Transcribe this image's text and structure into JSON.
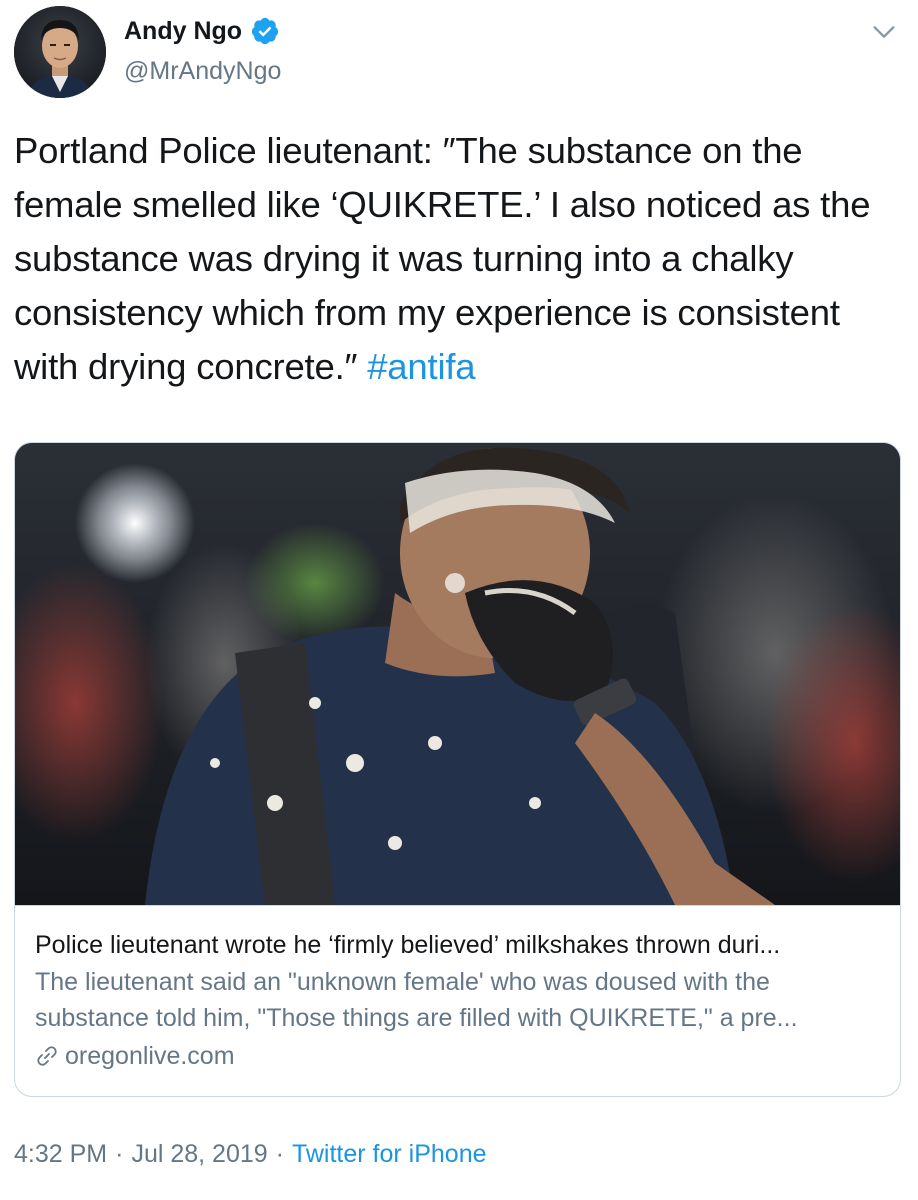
{
  "author": {
    "display_name": "Andy Ngo",
    "handle": "@MrAndyNgo",
    "verified": true
  },
  "tweet": {
    "text": "Portland Police lieutenant: ″The substance on the female smelled like ‘QUIKRETE.’ I also noticed as the substance was drying it was turning into a chalky consistency which from my experience is consistent with drying concrete.″ ",
    "hashtag": "#antifa"
  },
  "card": {
    "title": "Police lieutenant wrote he ‘firmly believed’ milkshakes thrown duri...",
    "description": "The lieutenant said an \"unknown female' who was doused with the substance told him, \"Those things are filled with QUIKRETE,\" a pre...",
    "domain": "oregonlive.com"
  },
  "footer": {
    "time": "4:32 PM",
    "separator1": "·",
    "date": "Jul 28, 2019",
    "separator2": "·",
    "source": "Twitter for iPhone"
  },
  "icons": {
    "verified": "verified-badge-icon",
    "caret": "chevron-down-icon",
    "link": "link-icon"
  },
  "colors": {
    "accent": "#1b95e0",
    "secondary_text": "#657786",
    "primary_text": "#14171a",
    "border": "#ccd6dd"
  }
}
